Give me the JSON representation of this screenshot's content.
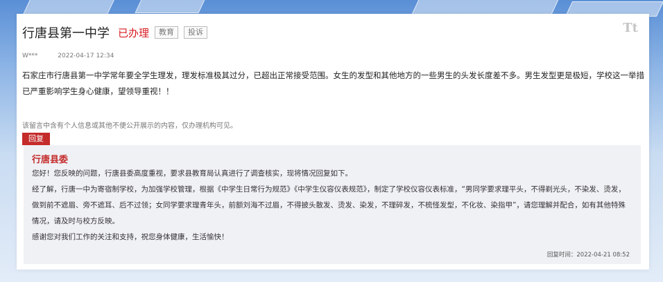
{
  "header": {
    "title": "行唐县第一中学",
    "status": "已办理",
    "tags": [
      "教育",
      "投诉"
    ]
  },
  "font_icon": "Tt",
  "meta": {
    "author": "W***",
    "date": "2022-04-17 12:34"
  },
  "message": {
    "content": "石家庄市行唐县第一中学常年要全学生理发，理发标准极其过分，已超出正常接受范围。女生的发型和其他地方的一些男生的头发长度差不多。男生发型更是极短，学校这一举措已严重影响学生身心健康，望领导重视！！"
  },
  "privacy_note": "该留言中含有个人信息或其他不便公开展示的内容，仅办理机构可见。",
  "reply": {
    "button_label": "回复",
    "responder": "行唐县委",
    "paragraphs": [
      "您好！您反映的问题，行唐县委高度重视，要求县教育局认真进行了调查核实，现将情况回复如下。",
      "经了解，行唐一中为寄宿制学校，为加强学校管理，根据《中学生日常行为规范》《中学生仪容仪表规范》，制定了学校仪容仪表标准，“男同学要求理平头，不得剃光头，不染发、烫发，做到前不遮眉、旁不遮耳、后不过领；女同学要求理青年头，前额刘海不过眉，不得披头散发、烫发、染发，不理碎发，不梳怪发型，不化妆、染指甲”，请您理解并配合，如有其他特殊情况，请及时与校方反映。",
      "感谢您对我们工作的关注和支持，祝您身体健康，生活愉快！"
    ],
    "time": "回复时间：2022-04-21 08:52"
  }
}
